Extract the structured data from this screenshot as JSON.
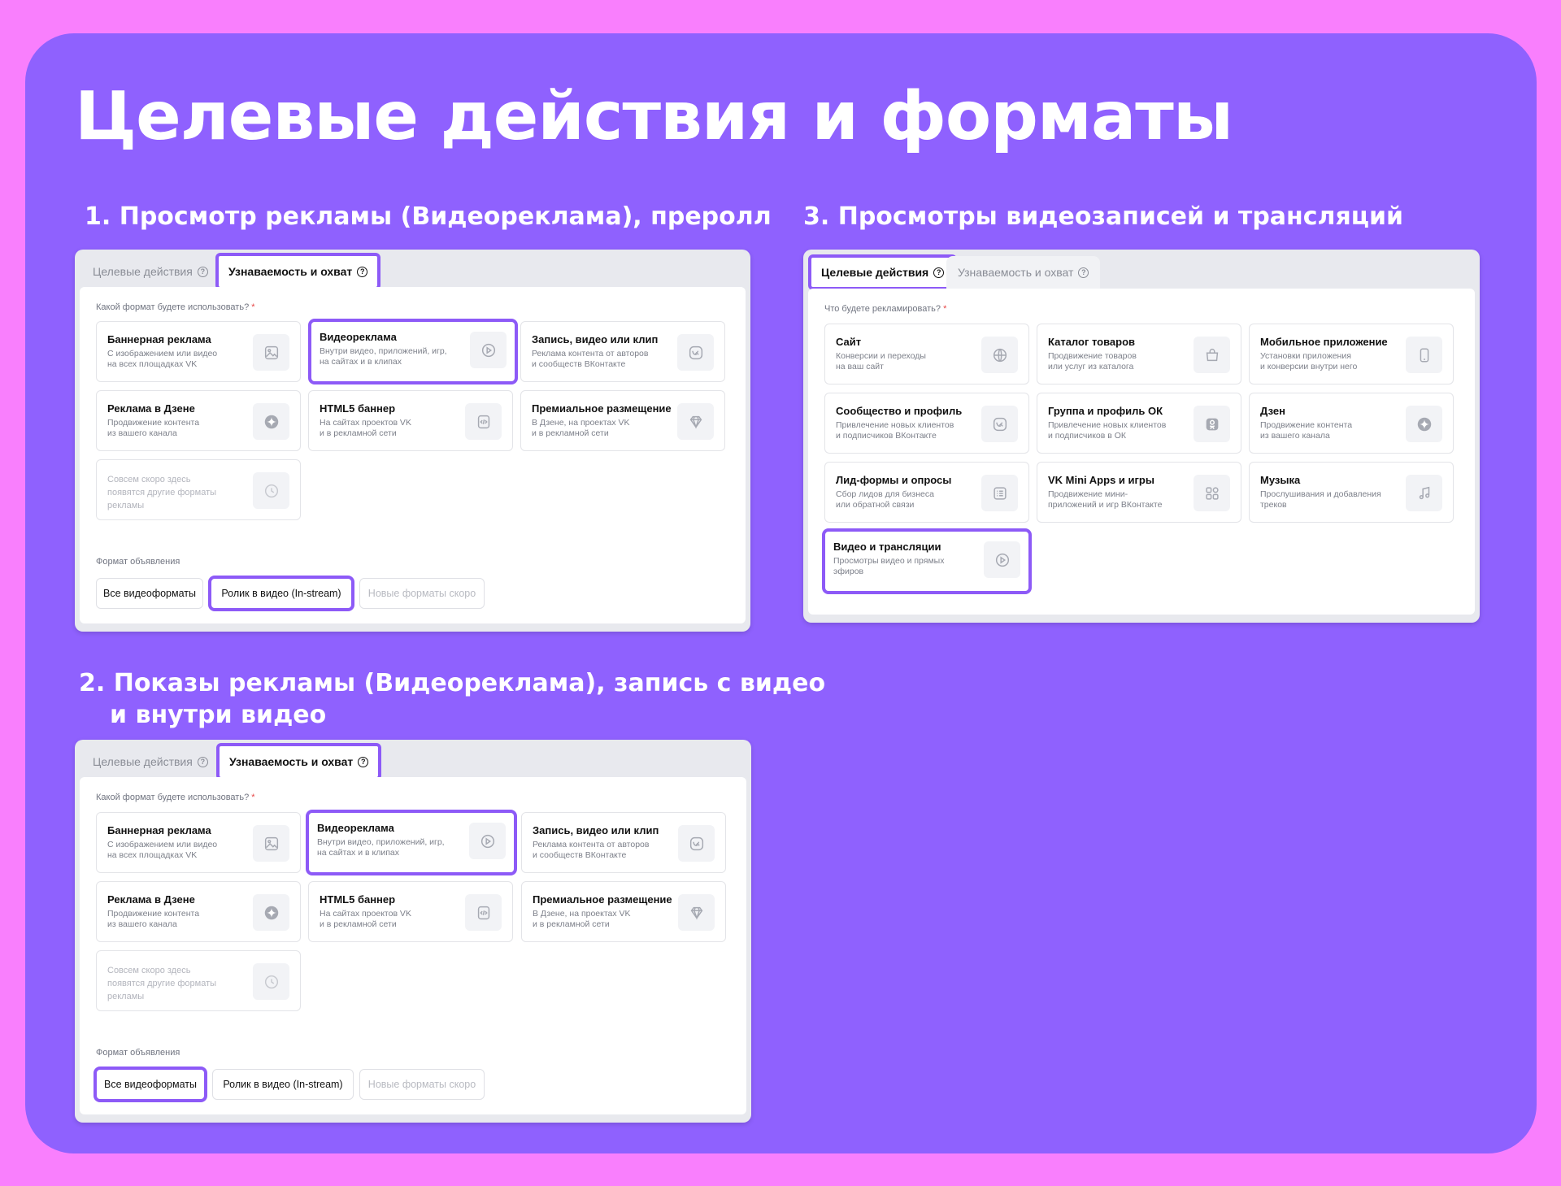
{
  "page_title": "Целевые действия и форматы",
  "sections": {
    "s1_title": "1. Просмотр рекламы (Видеореклама), преролл",
    "s2_title_line1": "2. Показы рекламы (Видеореклама), запись с видео",
    "s2_title_line2": "и внутри видео",
    "s3_title": "3. Просмотры видеозаписей и трансляций"
  },
  "tabs": {
    "target_actions": "Целевые действия",
    "awareness": "Узнаваемость и охват"
  },
  "format_question": "Какой формат будете использовать?",
  "advertise_question": "Что будете рекламировать?",
  "required_mark": "*",
  "ad_format_label": "Формат объявления",
  "formats": [
    {
      "title": "Баннерная реклама",
      "desc": "С изображением или видео\nна всех площадках VK",
      "icon": "image-icon"
    },
    {
      "title": "Видеореклама",
      "desc": "Внутри видео, приложений, игр,\nна сайтах и в клипах",
      "icon": "play-icon"
    },
    {
      "title": "Запись, видео или клип",
      "desc": "Реклама контента от авторов\nи сообществ ВКонтакте",
      "icon": "vk-icon"
    },
    {
      "title": "Реклама в Дзене",
      "desc": "Продвижение контента\nиз вашего канала",
      "icon": "dzen-icon"
    },
    {
      "title": "HTML5 баннер",
      "desc": "На сайтах проектов VK\nи в рекламной сети",
      "icon": "code-icon"
    },
    {
      "title": "Премиальное размещение",
      "desc": "В Дзене, на проектах VK\nи в рекламной сети",
      "icon": "diamond-icon"
    },
    {
      "title": "",
      "desc": "Совсем скоро здесь\nпоявятся другие форматы\nрекламы",
      "icon": "clock-icon"
    }
  ],
  "chips": [
    "Все видеоформаты",
    "Ролик в видео (In-stream)",
    "Новые форматы скоро"
  ],
  "objects": [
    {
      "title": "Сайт",
      "desc": "Конверсии и переходы\nна ваш сайт",
      "icon": "globe-icon"
    },
    {
      "title": "Каталог товаров",
      "desc": "Продвижение товаров\nили услуг из каталога",
      "icon": "bag-icon"
    },
    {
      "title": "Мобильное приложение",
      "desc": "Установки приложения\nи конверсии внутри него",
      "icon": "phone-icon"
    },
    {
      "title": "Сообщество и профиль",
      "desc": "Привлечение новых клиентов\nи подписчиков ВКонтакте",
      "icon": "vk-icon"
    },
    {
      "title": "Группа и профиль ОК",
      "desc": "Привлечение новых клиентов\nи подписчиков в ОК",
      "icon": "ok-icon"
    },
    {
      "title": "Дзен",
      "desc": "Продвижение контента\nиз вашего канала",
      "icon": "dzen-icon"
    },
    {
      "title": "Лид-формы и опросы",
      "desc": "Сбор лидов для бизнеса\nили обратной связи",
      "icon": "list-icon"
    },
    {
      "title": "VK Mini Apps и игры",
      "desc": "Продвижение мини-\nприложений и игр ВКонтакте",
      "icon": "apps-icon"
    },
    {
      "title": "Музыка",
      "desc": "Прослушивания и добавления\nтреков",
      "icon": "music-icon"
    },
    {
      "title": "Видео и трансляции",
      "desc": "Просмотры видео и прямых\nэфиров",
      "icon": "play-icon"
    }
  ],
  "colors": {
    "background": "#f97ffd",
    "card": "#8f61fe",
    "highlight": "#8d5af7"
  }
}
